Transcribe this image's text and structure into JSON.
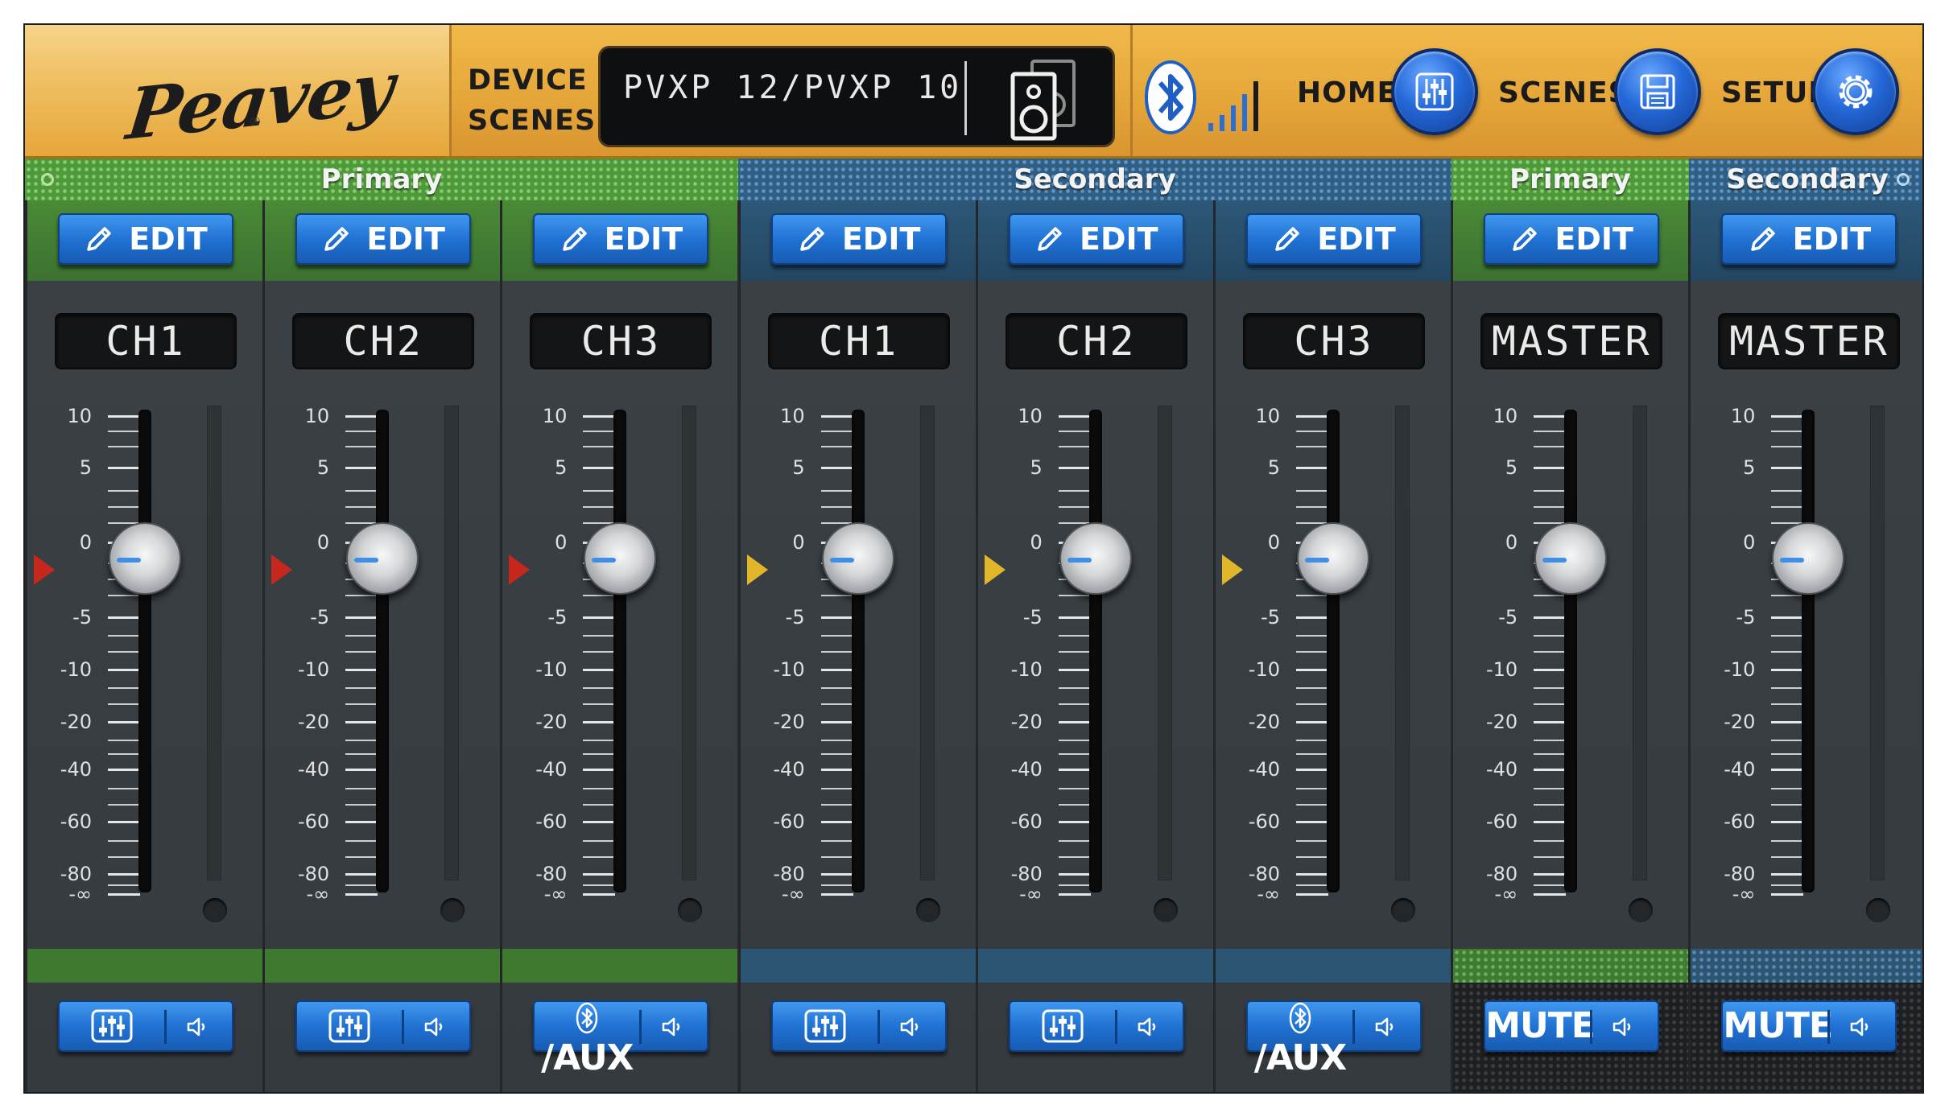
{
  "header": {
    "logo_text": "Peavey",
    "logo_mark": "®",
    "device_scenes_line1": "DEVICE",
    "device_scenes_line2": "SCENES",
    "device_name": "PVXP 12/PVXP 10",
    "device_icon": "speaker-pair-icon",
    "bluetooth_icon": "bluetooth-icon",
    "signal_icon": "signal-bars-icon",
    "nav": [
      {
        "label": "HOME",
        "icon": "faders-icon"
      },
      {
        "label": "SCENES",
        "icon": "save-icon"
      },
      {
        "label": "SETUP",
        "icon": "gear-icon"
      }
    ]
  },
  "groups": [
    {
      "label": "Primary",
      "color": "green"
    },
    {
      "label": "Secondary",
      "color": "blue"
    },
    {
      "label": "Primary",
      "color": "green"
    },
    {
      "label": "Secondary",
      "color": "blue"
    }
  ],
  "scale_labels": [
    "10",
    "5",
    "0",
    "-5",
    "-10",
    "-20",
    "-40",
    "-60",
    "-80",
    "-∞"
  ],
  "colors": {
    "primary_green": "#4e9a3a",
    "secondary_blue": "#2f5f86",
    "button_blue": "#1f6fd0",
    "marker_red": "#c6281d",
    "marker_yellow": "#e2b62b",
    "header_gold": "#e6a73a"
  },
  "strips": [
    {
      "edit": "EDIT",
      "name": "CH1",
      "group": "Primary",
      "fader_db": 0,
      "bottom_label": "",
      "bottom_icon": "eq-icon",
      "speaker_icon": "speaker-icon"
    },
    {
      "edit": "EDIT",
      "name": "CH2",
      "group": "Primary",
      "fader_db": 0,
      "bottom_label": "",
      "bottom_icon": "eq-icon",
      "speaker_icon": "speaker-icon"
    },
    {
      "edit": "EDIT",
      "name": "CH3",
      "group": "Primary",
      "fader_db": 0,
      "bottom_label": "/AUX",
      "bottom_icon": "bluetooth-icon",
      "speaker_icon": "speaker-icon"
    },
    {
      "edit": "EDIT",
      "name": "CH1",
      "group": "Secondary",
      "fader_db": 0,
      "bottom_label": "",
      "bottom_icon": "eq-icon",
      "speaker_icon": "speaker-icon"
    },
    {
      "edit": "EDIT",
      "name": "CH2",
      "group": "Secondary",
      "fader_db": 0,
      "bottom_label": "",
      "bottom_icon": "eq-icon",
      "speaker_icon": "speaker-icon"
    },
    {
      "edit": "EDIT",
      "name": "CH3",
      "group": "Secondary",
      "fader_db": 0,
      "bottom_label": "/AUX",
      "bottom_icon": "bluetooth-icon",
      "speaker_icon": "speaker-icon"
    },
    {
      "edit": "EDIT",
      "name": "MASTER",
      "group": "Primary",
      "fader_db": 0,
      "bottom_label": "MUTE",
      "bottom_icon": "",
      "speaker_icon": "speaker-icon"
    },
    {
      "edit": "EDIT",
      "name": "MASTER",
      "group": "Secondary",
      "fader_db": 0,
      "bottom_label": "MUTE",
      "bottom_icon": "",
      "speaker_icon": "speaker-icon"
    }
  ]
}
